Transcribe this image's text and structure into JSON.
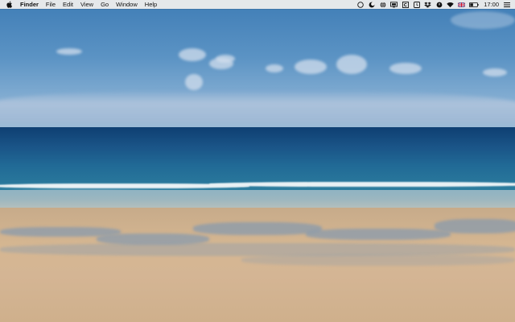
{
  "menubar": {
    "apple_icon": "apple-logo-icon",
    "app_name": "Finder",
    "menus": [
      "File",
      "Edit",
      "View",
      "Go",
      "Window",
      "Help"
    ],
    "status_icons": [
      "circle-icon",
      "half-moon-icon",
      "globe-icon",
      "display-icon",
      "square-c-icon",
      "timer-icon",
      "dropbox-icon",
      "timemachine-icon",
      "wifi-icon",
      "uk-flag-icon",
      "battery-icon"
    ],
    "clock": "17:00",
    "list_icon": "menu-list-icon"
  },
  "wallpaper": {
    "description_colors": {
      "sky": "#5b93c4",
      "sea": "#1a5487",
      "sand": "#d6b792"
    }
  }
}
